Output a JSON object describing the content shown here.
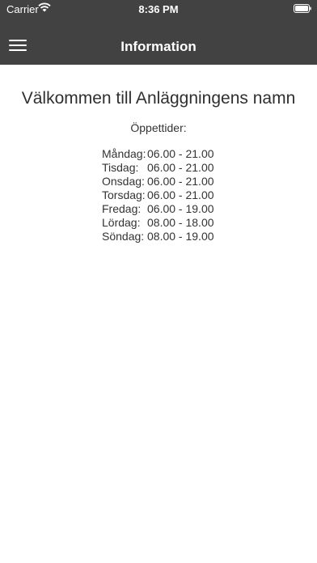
{
  "status_bar": {
    "carrier": "Carrier",
    "time": "8:36 PM"
  },
  "nav": {
    "title": "Information",
    "menu_icon": "hamburger-icon"
  },
  "main": {
    "welcome": "Välkommen till Anläggningens namn",
    "hours_label": "Öppettider:",
    "hours": [
      {
        "day": "Måndag:",
        "time": "06.00 - 21.00"
      },
      {
        "day": "Tisdag:",
        "time": "06.00 - 21.00"
      },
      {
        "day": "Onsdag:",
        "time": "06.00 - 21.00"
      },
      {
        "day": "Torsdag:",
        "time": "06.00 - 21.00"
      },
      {
        "day": "Fredag:",
        "time": "06.00 - 19.00"
      },
      {
        "day": "Lördag:",
        "time": "08.00 - 18.00"
      },
      {
        "day": "Söndag:",
        "time": "08.00 - 19.00"
      }
    ]
  },
  "colors": {
    "header_bg": "#424242",
    "page_bg": "#ffffff",
    "text": "#333333"
  }
}
